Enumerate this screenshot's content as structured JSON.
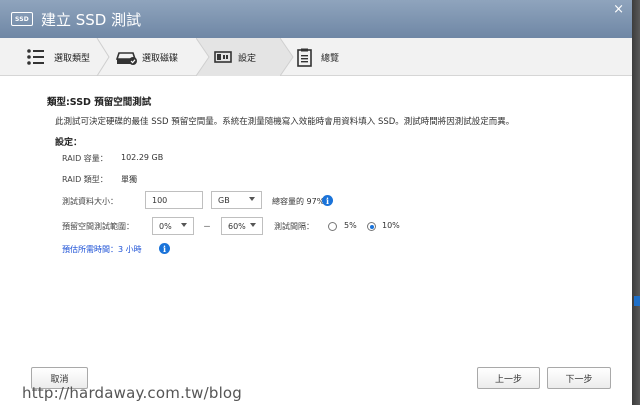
{
  "window": {
    "title": "建立 SSD 測試",
    "ssd_badge": "SSD",
    "close_glyph": "×"
  },
  "steps": [
    {
      "label": "選取類型",
      "icon": "list-icon"
    },
    {
      "label": "選取磁碟",
      "icon": "disk-check-icon"
    },
    {
      "label": "設定",
      "icon": "settings-panel-icon",
      "active": true
    },
    {
      "label": "總覽",
      "icon": "clipboard-icon"
    }
  ],
  "main": {
    "heading": "類型:SSD 預留空間測試",
    "description": "此測試可決定硬碟的最佳 SSD 預留空間量。系統在測量隨機寫入效能時會用資料填入 SSD。測試時間將因測試設定而異。",
    "settings_title": "設定："
  },
  "settings": {
    "raid_capacity_label": "RAID 容量：",
    "raid_capacity_value": "102.29 GB",
    "raid_type_label": "RAID 類型：",
    "raid_type_value": "單獨",
    "test_size_label": "測試資料大小：",
    "test_size_value": "100",
    "test_size_unit": "GB",
    "capacity_percent": "總容量的 97%",
    "range_label": "預留空間測試範圍：",
    "range_from": "0%",
    "range_dash": "－",
    "range_to": "60%",
    "interval_label": "測試間隔：",
    "interval_options": [
      "5%",
      "10%"
    ],
    "interval_selected": "10%",
    "estimate": "預估所需時間：3 小時"
  },
  "buttons": {
    "cancel": "取消",
    "back": "上一步",
    "next": "下一步"
  },
  "watermark": "http://hardaway.com.tw/blog",
  "colors": {
    "titlebar": "#7e95b2",
    "accent": "#1a73d9",
    "estimate_text": "#1a4fd6"
  }
}
